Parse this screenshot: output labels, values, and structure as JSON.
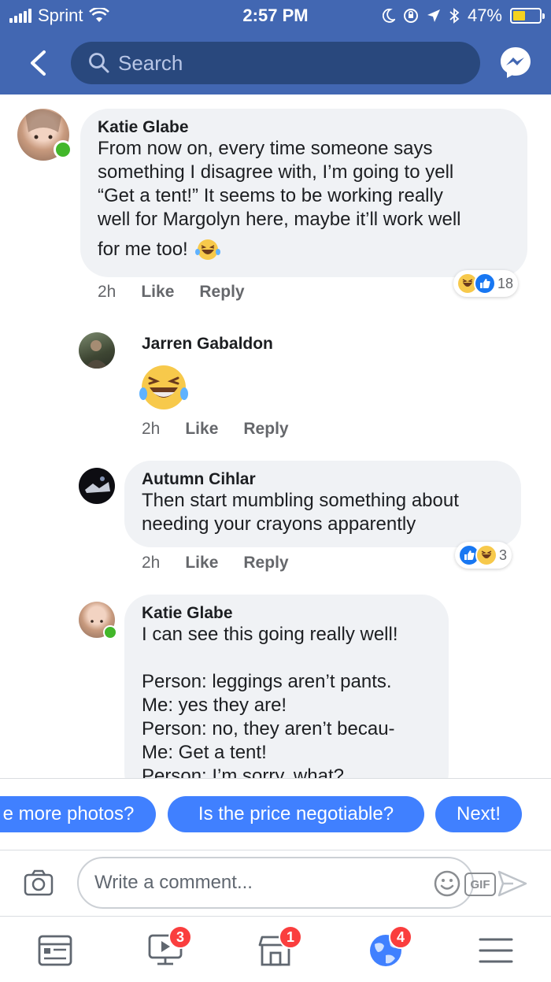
{
  "status_bar": {
    "carrier": "Sprint",
    "time": "2:57 PM",
    "battery": "47%",
    "battery_level": 0.47
  },
  "header": {
    "search_placeholder": "Search"
  },
  "comments": [
    {
      "author": "Katie Glabe",
      "lines": [
        "From now on, every time someone says",
        "something I disagree with, I’m going to yell",
        "“Get a tent!” It seems to be working really",
        "well for Margolyn here, maybe it’ll work well",
        "for me too!"
      ],
      "time": "2h",
      "like_label": "Like",
      "reply_label": "Reply",
      "reaction_count": "18",
      "online": true
    },
    {
      "author": "Jarren Gabaldon",
      "time": "2h",
      "like_label": "Like",
      "reply_label": "Reply"
    },
    {
      "author": "Autumn Cihlar",
      "lines": [
        "Then start mumbling something about",
        "needing your crayons apparently"
      ],
      "time": "2h",
      "like_label": "Like",
      "reply_label": "Reply",
      "reaction_count": "3"
    },
    {
      "author": "Katie Glabe",
      "lines": [
        "I can see this going really well!",
        "",
        "Person: leggings aren’t pants.",
        "Me: yes they are!",
        "Person: no, they aren’t becau-",
        "Me: Get a tent!",
        "Person: I’m sorry, what?"
      ],
      "online": true
    }
  ],
  "quick_replies": [
    "e more photos?",
    "Is the price negotiable?",
    "Next!"
  ],
  "composer": {
    "placeholder": "Write a comment...",
    "gif_label": "GIF"
  },
  "tabbar": {
    "badges": {
      "watch": "3",
      "marketplace": "1",
      "notifications": "4"
    }
  },
  "colors": {
    "brand": "#4267b2",
    "chip": "#4080ff",
    "online": "#42b72a",
    "badge": "#fa3e3e"
  }
}
